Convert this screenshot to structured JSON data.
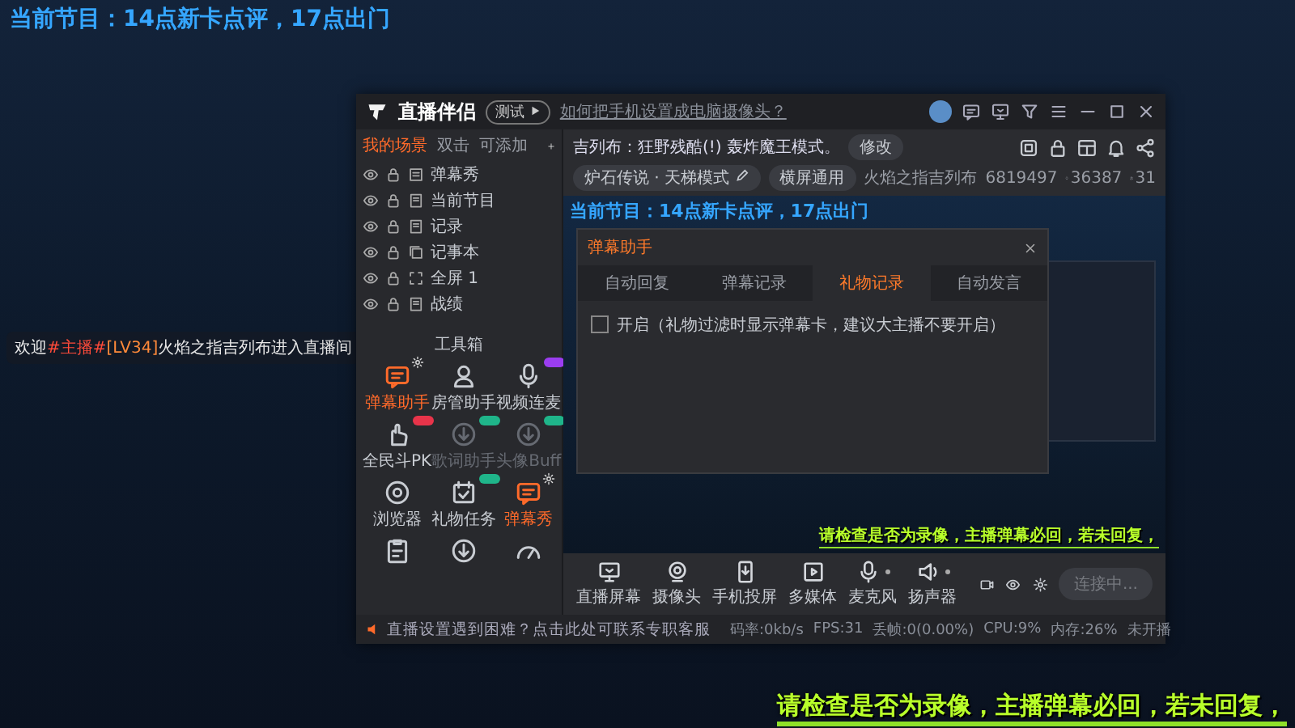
{
  "overlay_program": "当前节目：14点新卡点评，17点出门",
  "welcome": {
    "before": "欢迎",
    "role": "#主播#",
    "level_tag": "[LV34]",
    "user": "火焰之指吉列布",
    "after": "进入直播间"
  },
  "ticker": "请检查是否为录像，主播弹幕必回，若未回复，",
  "app": {
    "title_bar": {
      "title": "直播伴侣",
      "mode_badge": "测试",
      "help_link": "如何把手机设置成电脑摄像头？"
    },
    "scene_tabs": [
      {
        "label": "我的场景",
        "selected": true
      },
      {
        "label": "双击",
        "selected": false
      },
      {
        "label": "可添加",
        "selected": false
      }
    ],
    "scenes": [
      {
        "name": "弹幕秀",
        "kind": "danmaku"
      },
      {
        "name": "当前节目",
        "kind": "text"
      },
      {
        "name": "记录",
        "kind": "text"
      },
      {
        "name": "记事本",
        "kind": "window"
      },
      {
        "name": "全屏 1",
        "kind": "capture"
      },
      {
        "name": "战绩",
        "kind": "text"
      }
    ],
    "toolbox": {
      "title": "工具箱",
      "tools": [
        {
          "label": "弹幕助手",
          "kind": "danmaku",
          "active": true,
          "disabled": false,
          "badge": {
            "kind": "settings"
          }
        },
        {
          "label": "房管助手",
          "kind": "admin",
          "active": false,
          "disabled": false
        },
        {
          "label": "视频连麦",
          "kind": "call",
          "active": false,
          "disabled": false,
          "badge": {
            "kind": "tag",
            "color": "#9b3df0"
          }
        },
        {
          "label": "全民斗PK",
          "kind": "pk",
          "active": false,
          "disabled": false,
          "badge": {
            "kind": "tag",
            "color": "#e8344a"
          }
        },
        {
          "label": "歌词助手",
          "kind": "plugin",
          "active": false,
          "disabled": true,
          "badge": {
            "kind": "tag",
            "color": "#1fb58a"
          }
        },
        {
          "label": "头像Buff",
          "kind": "plugin",
          "active": false,
          "disabled": true,
          "badge": {
            "kind": "tag",
            "color": "#1fb58a"
          }
        },
        {
          "label": "浏览器",
          "kind": "browser",
          "active": false,
          "disabled": false
        },
        {
          "label": "礼物任务",
          "kind": "gift",
          "active": false,
          "disabled": false,
          "badge": {
            "kind": "tag",
            "color": "#1fb58a"
          }
        },
        {
          "label": "弹幕秀",
          "kind": "danmaku",
          "active": true,
          "disabled": false,
          "badge": {
            "kind": "settings"
          }
        },
        {
          "kind": "notes",
          "active": false,
          "disabled": false
        },
        {
          "kind": "plugin",
          "active": false,
          "disabled": false
        },
        {
          "kind": "speed",
          "active": false,
          "disabled": false
        }
      ]
    },
    "notice": "直播设置遇到困难？点击此处可联系专职客服",
    "stream_info": {
      "title": "吉列布：狂野残酷(!) 轰炸魔王模式。",
      "edit_button": "修改",
      "category": "炉石传说 · 天梯模式",
      "layout_button": "横屏通用",
      "anchor": "火焰之指吉列布",
      "room_id": "6819497",
      "popularity": "36387",
      "viewers": "31"
    },
    "preview": {
      "program": "当前节目：14点新卡点评，17点出门",
      "ticker": "请检查是否为录像，主播弹幕必回，若未回复，",
      "dialog": {
        "title": "弹幕助手",
        "tabs": [
          {
            "label": "自动回复",
            "selected": false
          },
          {
            "label": "弹幕记录",
            "selected": false
          },
          {
            "label": "礼物记录",
            "selected": true
          },
          {
            "label": "自动发言",
            "selected": false
          }
        ],
        "option": {
          "label": "开启（礼物过滤时显示弹幕卡，建议大主播不要开启）",
          "checked": false
        }
      }
    },
    "sources": [
      {
        "label": "直播屏幕",
        "kind": "screen",
        "dropdown": false
      },
      {
        "label": "摄像头",
        "kind": "camera",
        "dropdown": false
      },
      {
        "label": "手机投屏",
        "kind": "phone",
        "dropdown": false
      },
      {
        "label": "多媒体",
        "kind": "media",
        "dropdown": false
      },
      {
        "label": "麦克风",
        "kind": "mic",
        "dropdown": true
      },
      {
        "label": "扬声器",
        "kind": "speaker",
        "dropdown": true
      }
    ],
    "connect_button": {
      "label": "连接中...",
      "disabled": true
    },
    "status": [
      "码率:0kb/s",
      "FPS:31",
      "丢帧:0(0.00%)",
      "CPU:9%",
      "内存:26%",
      "未开播"
    ]
  }
}
